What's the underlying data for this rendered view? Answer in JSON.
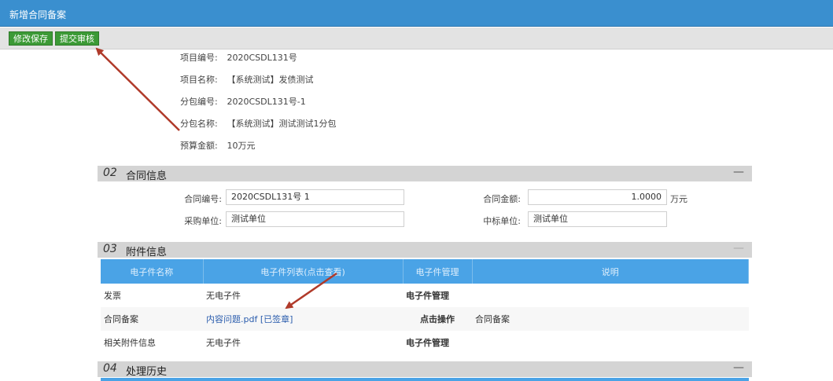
{
  "window": {
    "title": "新增合同备案"
  },
  "toolbar": {
    "save_label": "修改保存",
    "submit_label": "提交审核"
  },
  "project": [
    {
      "key": "项目编号:",
      "value": "2020CSDL131号"
    },
    {
      "key": "项目名称:",
      "value": "【系统测试】发债测试"
    },
    {
      "key": "分包编号:",
      "value": "2020CSDL131号-1"
    },
    {
      "key": "分包名称:",
      "value": "【系统测试】测试测试1分包"
    },
    {
      "key": "预算金额:",
      "value": "10万元"
    }
  ],
  "contract_section": {
    "num": "02",
    "title": "合同信息",
    "collapse": "—",
    "contract_no_label": "合同编号:",
    "contract_no": "2020CSDL131号 1",
    "amount_label": "合同金额:",
    "amount": "1.0000",
    "amount_unit": "万元",
    "buyer_label": "采购单位:",
    "buyer": "测试单位",
    "winner_label": "中标单位:",
    "winner": "测试单位"
  },
  "attachment_section": {
    "num": "03",
    "title": "附件信息",
    "collapse": "—",
    "headers": [
      "电子件名称",
      "电子件列表(点击查看)",
      "电子件管理",
      "说明"
    ],
    "rows": [
      {
        "name": "发票",
        "file": "无电子件",
        "manage": "电子件管理",
        "note": ""
      },
      {
        "name": "合同备案",
        "file": "内容问题.pdf",
        "status": "[已签章]",
        "manage": "点击操作",
        "note": "合同备案"
      },
      {
        "name": "相关附件信息",
        "file": "无电子件",
        "manage": "电子件管理",
        "note": ""
      }
    ]
  },
  "history_section": {
    "num": "04",
    "title": "处理历史",
    "collapse": "—"
  },
  "colors": {
    "titlebar": "#3a8fcf",
    "button": "#3c9a36",
    "table_header": "#4aa3e6",
    "arrow": "#b03a2a"
  }
}
